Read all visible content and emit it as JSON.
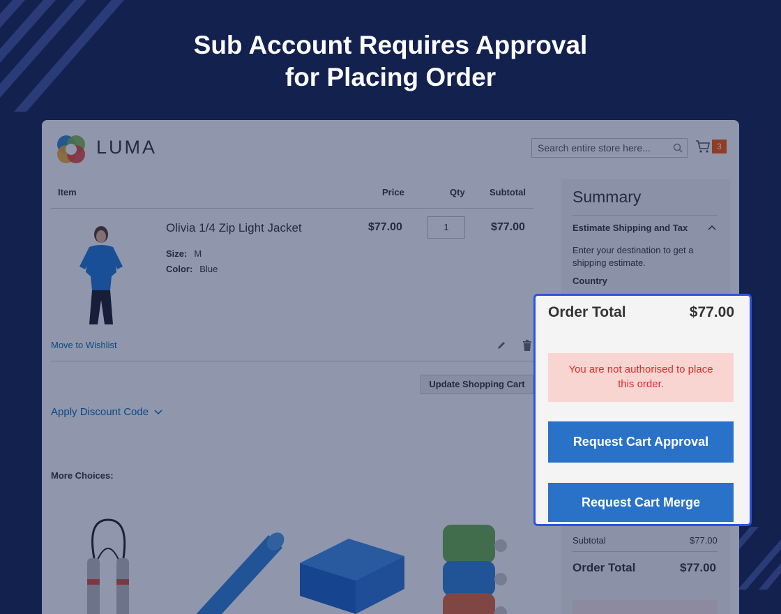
{
  "headline": {
    "line1": "Sub Account Requires Approval",
    "line2": "for Placing Order"
  },
  "store": {
    "logo_text": "LUMA",
    "search_placeholder": "Search entire store here...",
    "cart_count": "3",
    "columns": {
      "item": "Item",
      "price": "Price",
      "qty": "Qty",
      "subtotal": "Subtotal"
    },
    "product": {
      "name": "Olivia 1/4 Zip Light Jacket",
      "price": "$77.00",
      "qty": "1",
      "subtotal": "$77.00",
      "options": [
        {
          "label": "Size:",
          "value": "M"
        },
        {
          "label": "Color:",
          "value": "Blue"
        }
      ]
    },
    "move_to_wishlist": "Move to Wishlist",
    "update_cart": "Update Shopping Cart",
    "apply_discount": "Apply Discount Code",
    "more_choices": "More Choices:"
  },
  "summary": {
    "title": "Summary",
    "estimate_heading": "Estimate Shipping and Tax",
    "estimate_text": "Enter your destination to get a shipping estimate.",
    "country_label": "Country",
    "subtotal_label": "Subtotal",
    "subtotal_value": "$77.00",
    "order_total_label": "Order Total",
    "order_total_value": "$77.00"
  },
  "card": {
    "order_total_label": "Order Total",
    "order_total_value": "$77.00",
    "alert": "You are not authorised to place this order.",
    "request_approval": "Request Cart Approval",
    "request_merge": "Request Cart Merge"
  },
  "colors": {
    "background": "#13214f",
    "card_border": "#2b54e0",
    "button": "#2a72c8",
    "alert_bg": "#f9d5d2",
    "alert_text": "#e02b27",
    "cart_badge": "#ff5501",
    "link": "#006bb4"
  },
  "icons": [
    "search-icon",
    "cart-icon",
    "edit-icon",
    "trash-icon",
    "chevron-down-icon",
    "chevron-up-icon",
    "luma-logo"
  ]
}
